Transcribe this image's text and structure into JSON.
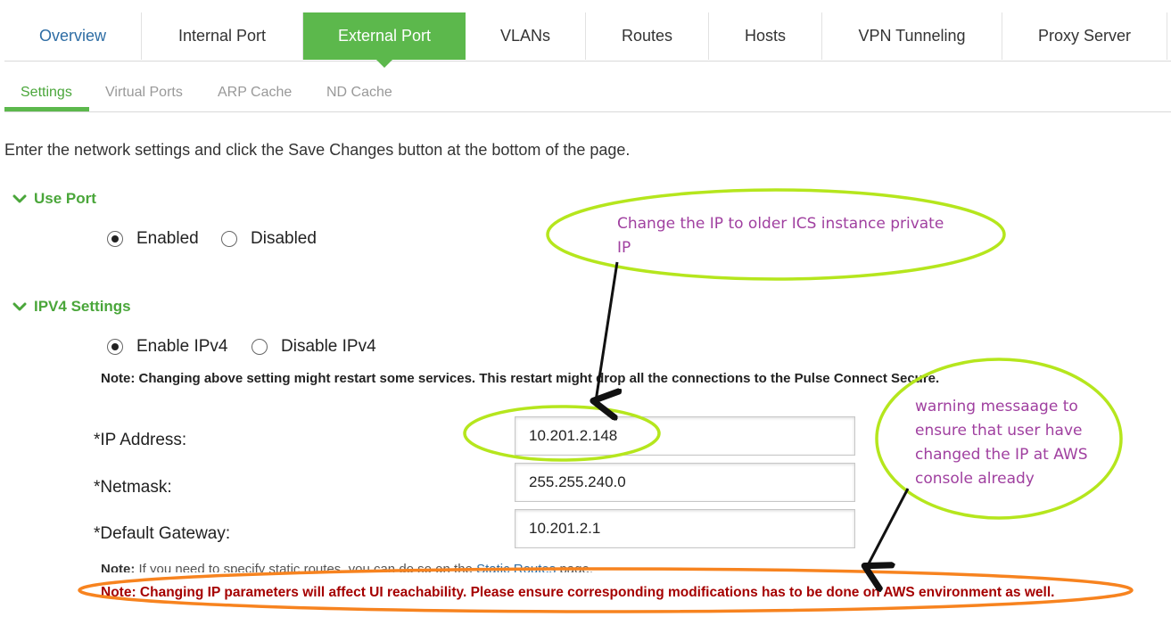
{
  "tabs": [
    {
      "label": "Overview"
    },
    {
      "label": "Internal Port"
    },
    {
      "label": "External Port"
    },
    {
      "label": "VLANs"
    },
    {
      "label": "Routes"
    },
    {
      "label": "Hosts"
    },
    {
      "label": "VPN Tunneling"
    },
    {
      "label": "Proxy Server"
    }
  ],
  "active_tab": "External Port",
  "subtabs": [
    {
      "label": "Settings"
    },
    {
      "label": "Virtual Ports"
    },
    {
      "label": "ARP Cache"
    },
    {
      "label": "ND Cache"
    }
  ],
  "active_subtab": "Settings",
  "intro": "Enter the network settings and click the Save Changes button at the bottom of the page.",
  "use_port": {
    "title": "Use Port",
    "options": [
      "Enabled",
      "Disabled"
    ],
    "selected": "Enabled"
  },
  "ipv4": {
    "title": "IPV4 Settings",
    "options": [
      "Enable IPv4",
      "Disable IPv4"
    ],
    "selected": "Enable IPv4",
    "note": "Note: Changing above setting might restart some services. This restart might drop all the connections to the Pulse Connect Secure."
  },
  "fields": {
    "ip_label": "*IP Address:",
    "ip_value": "10.201.2.148",
    "netmask_label": "*Netmask:",
    "netmask_value": "255.255.240.0",
    "gateway_label": "*Default Gateway:",
    "gateway_value": "10.201.2.1"
  },
  "static_note": {
    "prefix": "Note:",
    "text": " If you need to specify static routes, you can do so on the ",
    "link": "Static Routes",
    "suffix": " page."
  },
  "warning_note": "Note: Changing IP parameters will affect UI reachability. Please ensure corresponding modifications has to be done on AWS environment as well.",
  "annotations": {
    "callout_ip_line1": "Change the IP to older ICS instance private",
    "callout_ip_line2": "IP",
    "callout_warn_lines": [
      "warning messaage to",
      "ensure that user have",
      "changed the IP at AWS",
      "console already"
    ]
  },
  "colors": {
    "accent_green": "#5cb84c",
    "link_blue": "#2e6da4",
    "warning_red": "#a50000",
    "annotation_lime": "#b5e61d",
    "annotation_orange": "#f7831f",
    "annotation_text": "#a040a0"
  },
  "icons": {
    "section_toggle": "chevron-down-icon"
  }
}
